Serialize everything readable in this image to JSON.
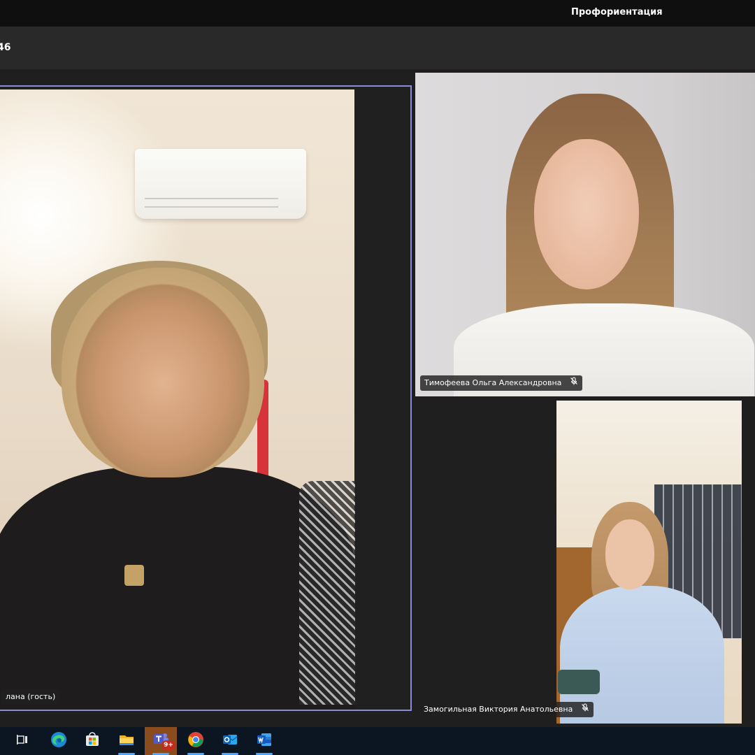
{
  "window": {
    "title": "Профориентация"
  },
  "meeting": {
    "timer": "46"
  },
  "participants": [
    {
      "name": "лана (гость)",
      "muted": false,
      "pinned": true
    },
    {
      "name": "Тимофеева Ольга Александровна",
      "muted": true
    },
    {
      "name": "Замогильная Виктория Анатольевна",
      "muted": true
    }
  ],
  "taskbar": {
    "items": [
      {
        "icon": "task-view-icon"
      },
      {
        "icon": "edge-icon"
      },
      {
        "icon": "store-icon"
      },
      {
        "icon": "file-explorer-icon"
      },
      {
        "icon": "teams-icon",
        "badge": "9+",
        "active": true
      },
      {
        "icon": "chrome-icon"
      },
      {
        "icon": "outlook-icon"
      },
      {
        "icon": "word-icon"
      }
    ]
  },
  "colors": {
    "active_speaker_border": "#8b8bd8",
    "taskbar_bg": "#0c1622",
    "teams_active_bg": "#8a4c1c"
  }
}
